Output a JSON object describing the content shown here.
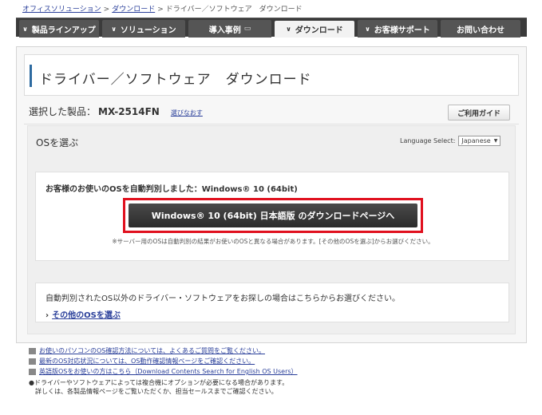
{
  "breadcrumb": {
    "items": [
      "オフィスソリューション",
      "ダウンロード"
    ],
    "current": "ドライバー／ソフトウェア　ダウンロード",
    "separator": ">"
  },
  "nav": {
    "tabs": [
      {
        "label": "製品ラインアップ"
      },
      {
        "label": "ソリューション"
      },
      {
        "label": "導入事例"
      },
      {
        "label": "ダウンロード"
      },
      {
        "label": "お客様サポート"
      },
      {
        "label": "お問い合わせ"
      }
    ],
    "active_tab": "ダウンロード"
  },
  "page": {
    "title": "ドライバー／ソフトウェア　ダウンロード",
    "selected_label": "選択した製品：",
    "model": "MX-2514FN",
    "reselect_link": "選びなおす",
    "guide_button": "ご利用ガイド"
  },
  "os_panel": {
    "heading": "OSを選ぶ",
    "language_label": "Language Select:",
    "language_value": "Japanese",
    "detected_text": "お客様のお使いのOSを自動判別しました：Windows® 10 (64bit)",
    "download_button": "Windows® 10 (64bit) 日本語版 のダウンロードページへ",
    "note": "※サーバー用のOSは自動判別の結果がお使いのOSと異なる場合があります。[その他のOSを選ぶ]からお選びください。",
    "other_text": "自動判別されたOS以外のドライバー・ソフトウェアをお探しの場合はこちらからお選びください。",
    "other_link": "その他のOSを選ぶ"
  },
  "links": [
    {
      "label": "お使いのパソコンのOS確認方法については、よくあるご質問をご覧ください。"
    },
    {
      "label": "最新のOS対応状況については、OS動作確認情報ページをご確認ください。"
    },
    {
      "label": "英語版OSをお使いの方はこちら（Download Contents Search for English OS Users）"
    }
  ],
  "footnote": {
    "line1": "●ドライバーやソフトウェアによっては複合機にオプションが必要になる場合があります。",
    "line2": "　詳しくは、各製品情報ページをご覧いただくか、担当セールスまでご確認ください。"
  },
  "colors": {
    "nav_bg": "#3b3b3b",
    "tab_bg": "#555555",
    "accent_blue": "#2d6aa0",
    "highlight_red": "#e0101e",
    "link": "#2a3f9a"
  }
}
